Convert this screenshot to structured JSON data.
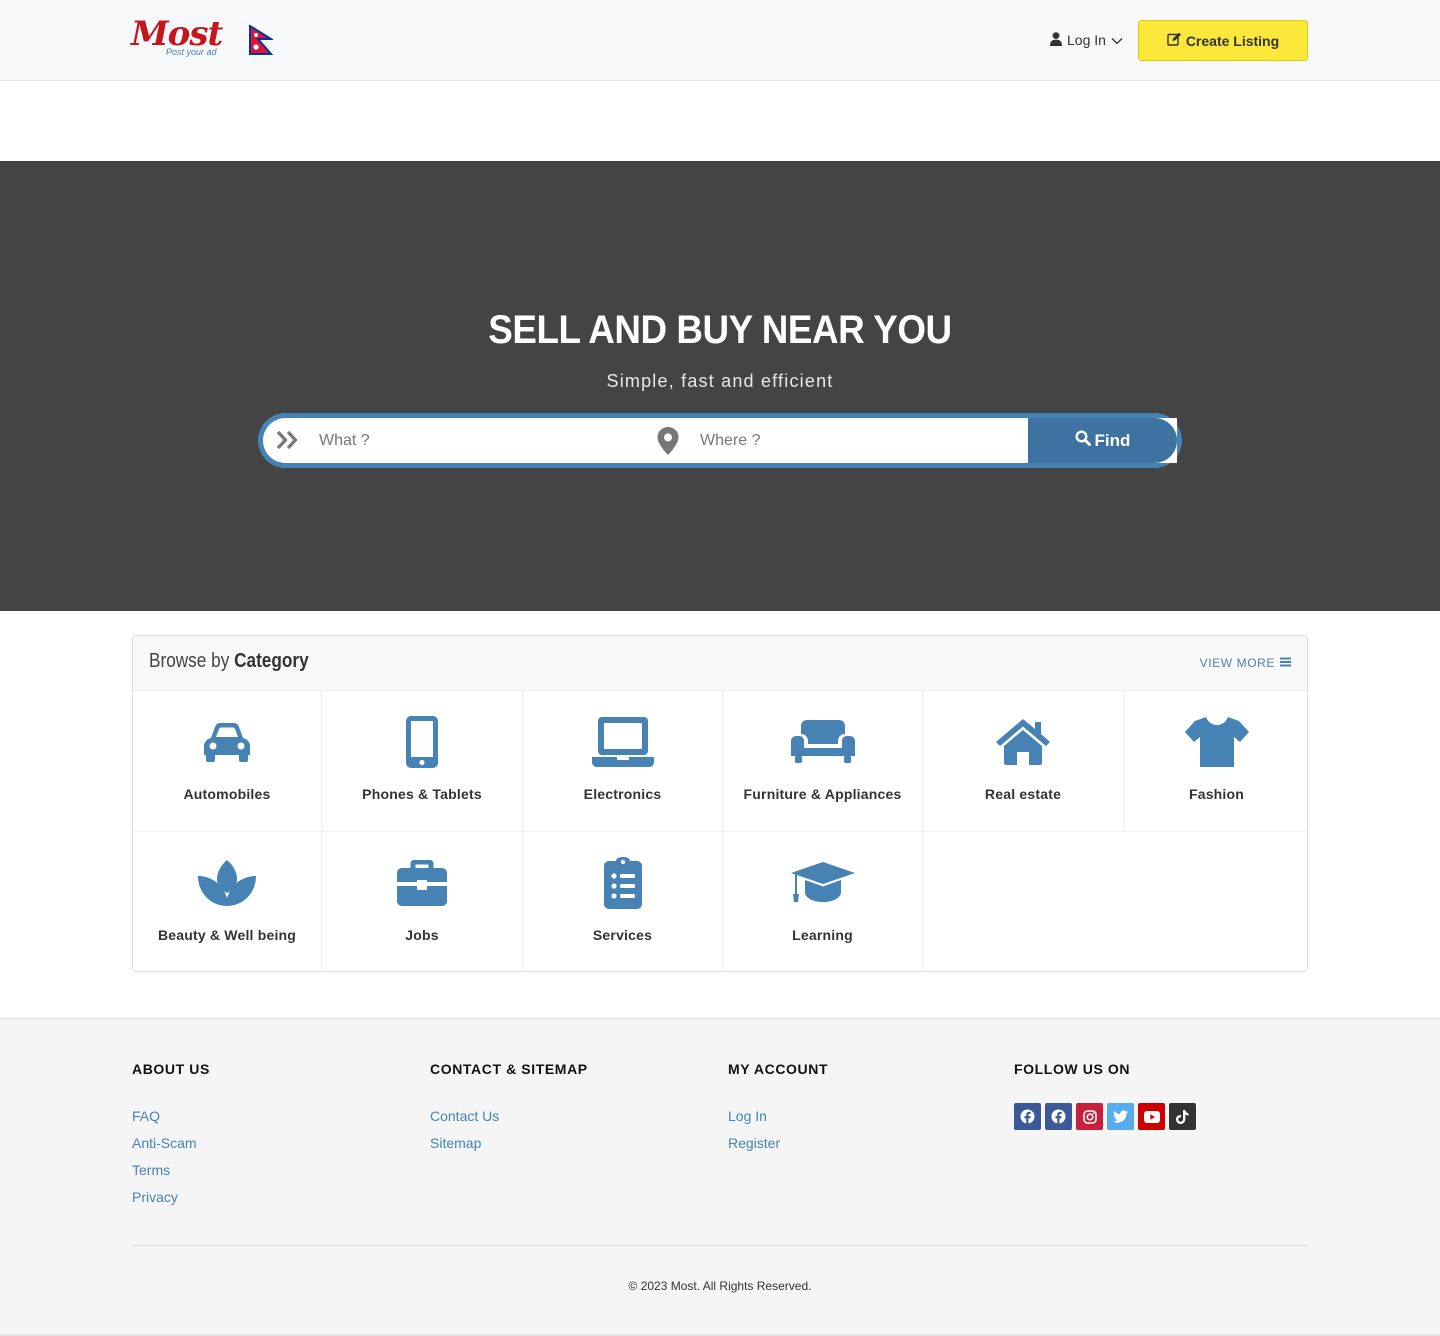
{
  "brand": {
    "logo_text": "Most",
    "logo_tagline": "Post your ad",
    "accent": "#4682b4",
    "logo_red": "#c4161c",
    "button_yellow": "#fce83a"
  },
  "header": {
    "login_label": "Log In",
    "create_label": "Create Listing"
  },
  "hero": {
    "title": "SELL AND BUY NEAR YOU",
    "subtitle": "Simple, fast and efficient",
    "what_placeholder": "What ?",
    "where_placeholder": "Where ?",
    "find_label": "Find"
  },
  "categories": {
    "title_light": "Browse by",
    "title_bold": "Category",
    "view_more": "VIEW MORE",
    "items": [
      {
        "label": "Automobiles",
        "icon": "car-icon"
      },
      {
        "label": "Phones & Tablets",
        "icon": "mobile-phone-icon"
      },
      {
        "label": "Electronics",
        "icon": "laptop-icon"
      },
      {
        "label": "Furniture & Appliances",
        "icon": "couch-icon"
      },
      {
        "label": "Real estate",
        "icon": "house-icon"
      },
      {
        "label": "Fashion",
        "icon": "tshirt-icon"
      },
      {
        "label": "Beauty & Well being",
        "icon": "spa-lotus-icon"
      },
      {
        "label": "Jobs",
        "icon": "briefcase-icon"
      },
      {
        "label": "Services",
        "icon": "clipboard-list-icon"
      },
      {
        "label": "Learning",
        "icon": "graduation-cap-icon"
      }
    ]
  },
  "footer": {
    "about": {
      "heading": "About us",
      "links": [
        "FAQ",
        "Anti-Scam",
        "Terms",
        "Privacy"
      ]
    },
    "contact": {
      "heading": "Contact & Sitemap",
      "links": [
        "Contact Us",
        "Sitemap"
      ]
    },
    "account": {
      "heading": "My Account",
      "links": [
        "Log In",
        "Register"
      ]
    },
    "follow": {
      "heading": "Follow us on",
      "socials": [
        {
          "icon": "facebook-icon",
          "color": "#3b5998"
        },
        {
          "icon": "facebook-icon",
          "color": "#3b5998"
        },
        {
          "icon": "instagram-icon",
          "color": "#d6249f"
        },
        {
          "icon": "twitter-icon",
          "color": "#55acee"
        },
        {
          "icon": "youtube-icon",
          "color": "#cc0000"
        },
        {
          "icon": "tiktok-icon",
          "color": "#333333"
        }
      ]
    },
    "copyright": "© 2023 Most. All Rights Reserved."
  }
}
